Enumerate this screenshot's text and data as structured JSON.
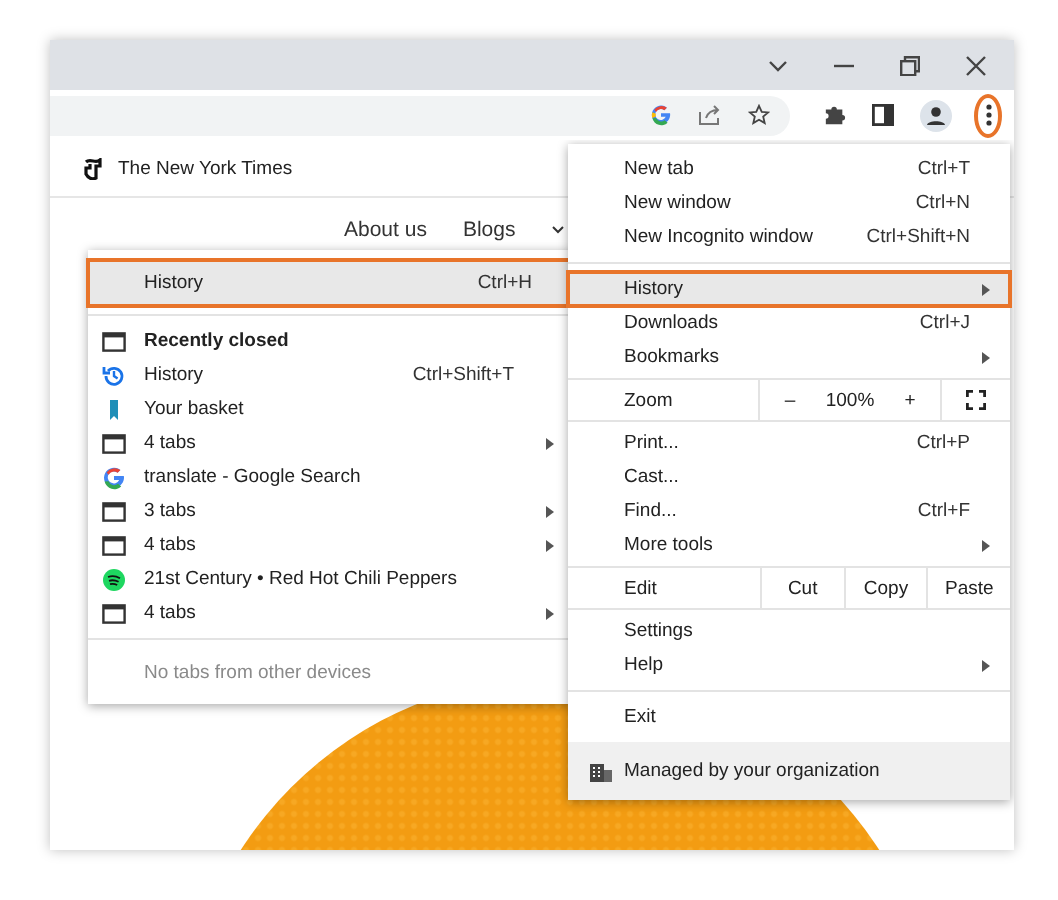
{
  "toolbar": {
    "menu_button": {
      "selected": true
    }
  },
  "page": {
    "site_title": "The New York Times",
    "nav": [
      "About us",
      "Blogs"
    ]
  },
  "history_submenu": {
    "header": {
      "label": "History",
      "shortcut": "Ctrl+H",
      "selected": true
    },
    "section_title": "Recently closed",
    "items": [
      {
        "kind": "history",
        "label": "History",
        "shortcut": "Ctrl+Shift+T",
        "has_submenu": false
      },
      {
        "kind": "basket",
        "label": "Your basket",
        "has_submenu": false
      },
      {
        "kind": "tabs",
        "label": "4 tabs",
        "has_submenu": true
      },
      {
        "kind": "google",
        "label": "translate - Google Search",
        "has_submenu": false
      },
      {
        "kind": "tabs",
        "label": "3 tabs",
        "has_submenu": true
      },
      {
        "kind": "tabs",
        "label": "4 tabs",
        "has_submenu": true
      },
      {
        "kind": "music",
        "label": "21st Century • Red Hot Chili Peppers",
        "has_submenu": false
      },
      {
        "kind": "tabs",
        "label": "4 tabs",
        "has_submenu": true
      }
    ],
    "footer": {
      "label": "No tabs from other devices",
      "disabled": true
    }
  },
  "main_menu": {
    "items": [
      {
        "kind": "item",
        "label": "New tab",
        "shortcut": "Ctrl+T",
        "has_submenu": false,
        "selected": false
      },
      {
        "kind": "item",
        "label": "New window",
        "shortcut": "Ctrl+N",
        "has_submenu": false,
        "selected": false
      },
      {
        "kind": "item",
        "label": "New Incognito window",
        "shortcut": "Ctrl+Shift+N",
        "has_submenu": false,
        "selected": false
      },
      {
        "kind": "separator"
      },
      {
        "kind": "item",
        "label": "History",
        "has_submenu": true,
        "selected": true
      },
      {
        "kind": "item",
        "label": "Downloads",
        "shortcut": "Ctrl+J",
        "has_submenu": false,
        "selected": false
      },
      {
        "kind": "item",
        "label": "Bookmarks",
        "has_submenu": true,
        "selected": false
      },
      {
        "kind": "zoom",
        "label": "Zoom",
        "minus": "–",
        "value": "100%",
        "plus": "+"
      },
      {
        "kind": "item",
        "label": "Print...",
        "shortcut": "Ctrl+P",
        "has_submenu": false,
        "selected": false
      },
      {
        "kind": "item",
        "label": "Cast...",
        "has_submenu": false,
        "selected": false
      },
      {
        "kind": "item",
        "label": "Find...",
        "shortcut": "Ctrl+F",
        "has_submenu": false,
        "selected": false
      },
      {
        "kind": "item",
        "label": "More tools",
        "has_submenu": true,
        "selected": false
      },
      {
        "kind": "edit",
        "label": "Edit",
        "actions": [
          "Cut",
          "Copy",
          "Paste"
        ]
      },
      {
        "kind": "item",
        "label": "Settings",
        "has_submenu": false,
        "selected": false
      },
      {
        "kind": "item",
        "label": "Help",
        "has_submenu": true,
        "selected": false
      },
      {
        "kind": "separator"
      },
      {
        "kind": "item",
        "label": "Exit",
        "has_submenu": false,
        "selected": false
      },
      {
        "kind": "managed",
        "label": "Managed by your organization"
      }
    ]
  }
}
